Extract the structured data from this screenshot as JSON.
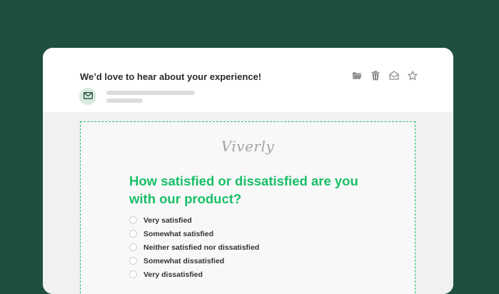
{
  "email": {
    "subject": "We’d love to hear about your experience!",
    "toolbar": [
      {
        "icon": "folder-icon"
      },
      {
        "icon": "trash-icon"
      },
      {
        "icon": "envelope-open-icon"
      },
      {
        "icon": "star-icon"
      }
    ],
    "sender_avatar_icon": "envelope-icon"
  },
  "survey": {
    "brand": "Viverly",
    "question": "How satisfied or dissatisfied are you with our product?",
    "options": [
      {
        "label": "Very satisfied"
      },
      {
        "label": "Somewhat satisfied"
      },
      {
        "label": "Neither satisfied nor dissatisfied"
      },
      {
        "label": "Somewhat dissatisfied"
      },
      {
        "label": "Very dissatisfied"
      }
    ]
  },
  "colors": {
    "background": "#1f4f3d",
    "accent": "#18bf68",
    "avatar_bg": "#d8ebdf"
  }
}
